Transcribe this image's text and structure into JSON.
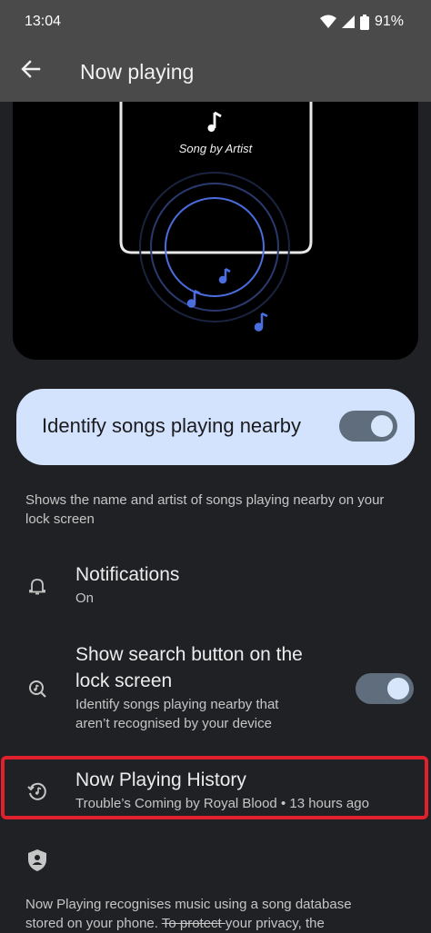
{
  "status_bar": {
    "time": "13:04",
    "battery": "91%",
    "icons": [
      "wifi-icon",
      "signal-icon",
      "battery-icon"
    ]
  },
  "app_bar": {
    "title": "Now playing",
    "back_icon": "arrow-back-icon"
  },
  "illustration": {
    "caption": "Song by Artist",
    "icons": [
      "music-note-icon"
    ]
  },
  "main_toggle": {
    "label": "Identify songs playing nearby",
    "enabled": true
  },
  "description": "Shows the name and artist of songs playing nearby on your lock screen",
  "settings": {
    "notifications": {
      "title": "Notifications",
      "subtitle": "On",
      "icon": "bell-icon"
    },
    "search_button": {
      "title_line1": "Show search button on the",
      "title_line2": "lock screen",
      "subtitle_line1": "Identify songs playing nearby that",
      "subtitle_line2": "aren’t recognised by your device",
      "icon": "music-search-icon",
      "enabled": true
    },
    "history": {
      "title": "Now Playing History",
      "subtitle": "Trouble’s Coming by Royal Blood • 13 hours ago",
      "icon": "history-icon"
    },
    "privacy": {
      "icon": "shield-person-icon",
      "text_line1": "Now Playing recognises music using a song database",
      "text_line2_a": "stored on your phone. ",
      "text_line2_strike": "To protect ",
      "text_line2_b": "your privacy, the"
    }
  },
  "colors": {
    "background": "#202124",
    "app_bar": "#4a4a4a",
    "card": "#d3e3fd",
    "switch_track": "#5f6d7d",
    "highlight": "#e0202c",
    "accent_blue": "#4a6ee0"
  }
}
